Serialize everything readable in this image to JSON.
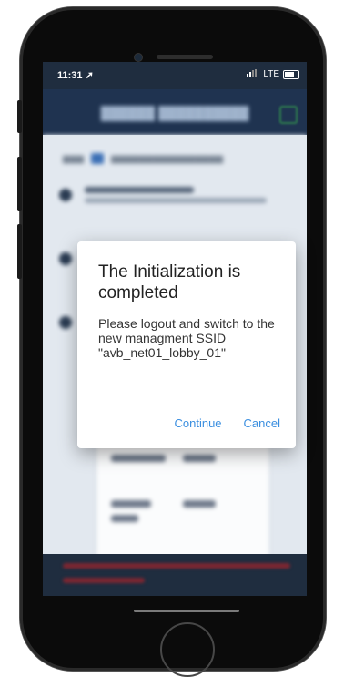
{
  "status_bar": {
    "time": "11:31",
    "location_glyph": "➚",
    "network": "LTE"
  },
  "dialog": {
    "title": "The Initialization is completed",
    "message": "Please logout and switch to the new managment SSID \"avb_net01_lobby_01\"",
    "continue_label": "Continue",
    "cancel_label": "Cancel",
    "accent_color": "#3b8fe0"
  },
  "colors": {
    "appbar": "#1f3350",
    "dialog_button": "#3b8fe0"
  }
}
